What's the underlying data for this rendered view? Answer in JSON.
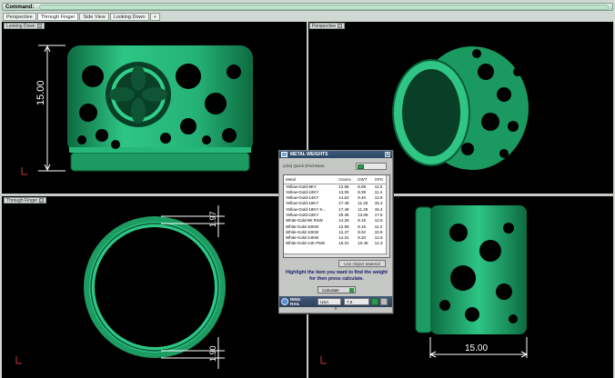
{
  "command": {
    "label": "Command:"
  },
  "tabs": [
    "Perspective",
    "Through Finger",
    "Side View",
    "Looking Down",
    "+"
  ],
  "viewports": {
    "top_left": {
      "label": "Looking Down",
      "dimension": "15.00"
    },
    "top_right": {
      "label": "Perspective"
    },
    "bottom_left": {
      "label": "Through Finger",
      "dim_top": "1.97",
      "dim_bottom": "1.90"
    },
    "bottom_right": {
      "dimension": "15.00"
    }
  },
  "dialog": {
    "title": "METAL WEIGHTS",
    "unit_label": "(Lbs) Quick-(Fed-More",
    "mode_select": "",
    "columns": [
      "Metal",
      "Grams",
      "DWT",
      "SPG"
    ],
    "rows": [
      [
        "Yellow-Gold-9KY",
        "12.58",
        "8.09",
        "11.0"
      ],
      [
        "Yellow-Gold-10KY",
        "13.05",
        "8.39",
        "11.4"
      ],
      [
        "Yellow-Gold-14KY",
        "14.62",
        "9.40",
        "12.9"
      ],
      [
        "Yellow-Gold-18KY",
        "17.49",
        "11.25",
        "15.4"
      ],
      [
        "Yellow-Gold-18KY K...",
        "17.49",
        "11.25",
        "15.4"
      ],
      [
        "Yellow-Gold-22KY",
        "20.35",
        "13.08",
        "17.9"
      ],
      [
        "White-Gold-9K R4W",
        "14.29",
        "9.19",
        "12.5"
      ],
      [
        "White-Gold-10KW",
        "12.69",
        "8.16",
        "11.2"
      ],
      [
        "White-Gold-10KW",
        "12.47",
        "8.02",
        "10.9"
      ],
      [
        "White-Gold-14KW",
        "14.31",
        "9.20",
        "12.6"
      ],
      [
        "White-Gold-14K P6W",
        "16.31",
        "10.49",
        "14.3"
      ]
    ],
    "selected_row": -1,
    "use_object_button": "Use Object Material",
    "hint": "Highlight the item you want to find the weight for then press calculate.",
    "calculate_button": "Calculate",
    "ring_label_1": "RING",
    "ring_label_2": "RAIL",
    "country": "USA",
    "size": "7.5",
    "footer": "x"
  },
  "colors": {
    "ring": "#1fa66c",
    "ring_light": "#3fd194",
    "ring_dark": "#0b5a36",
    "background": "#000000"
  }
}
